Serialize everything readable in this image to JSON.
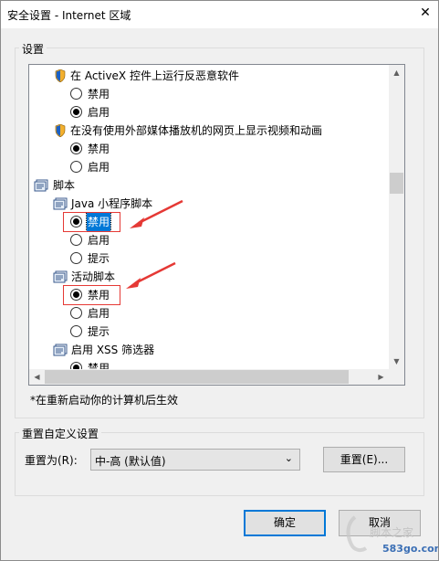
{
  "window": {
    "title": "安全设置 - Internet 区域",
    "close_glyph": "✕"
  },
  "settings": {
    "group_label": "设置",
    "items": [
      {
        "type": "setting",
        "label": "在 ActiveX 控件上运行反恶意软件"
      },
      {
        "type": "option",
        "label": "禁用",
        "checked": false
      },
      {
        "type": "option",
        "label": "启用",
        "checked": true
      },
      {
        "type": "setting",
        "label": "在没有使用外部媒体播放机的网页上显示视频和动画"
      },
      {
        "type": "option",
        "label": "禁用",
        "checked": true
      },
      {
        "type": "option",
        "label": "启用",
        "checked": false
      },
      {
        "type": "category",
        "label": "脚本"
      },
      {
        "type": "subcategory",
        "label": "Java 小程序脚本"
      },
      {
        "type": "option",
        "label": "禁用",
        "checked": true,
        "selected": true
      },
      {
        "type": "option",
        "label": "启用",
        "checked": false
      },
      {
        "type": "option",
        "label": "提示",
        "checked": false
      },
      {
        "type": "subcategory",
        "label": "活动脚本"
      },
      {
        "type": "option",
        "label": "禁用",
        "checked": true
      },
      {
        "type": "option",
        "label": "启用",
        "checked": false
      },
      {
        "type": "option",
        "label": "提示",
        "checked": false
      },
      {
        "type": "subcategory",
        "label": "启用 XSS 筛选器"
      },
      {
        "type": "option",
        "label": "禁用",
        "checked": true
      }
    ]
  },
  "note": "*在重新启动你的计算机后生效",
  "reset": {
    "group_label": "重置自定义设置",
    "reset_to_label": "重置为(R):",
    "level_value": "中-高 (默认值)",
    "reset_button": "重置(E)..."
  },
  "buttons": {
    "ok": "确定",
    "cancel": "取消"
  },
  "watermark": {
    "text": "脚本之家",
    "url": "583go.com"
  },
  "colors": {
    "selection": "#0078d7",
    "annotation": "#e53935",
    "dialog_bg": "#f0f0f0"
  }
}
